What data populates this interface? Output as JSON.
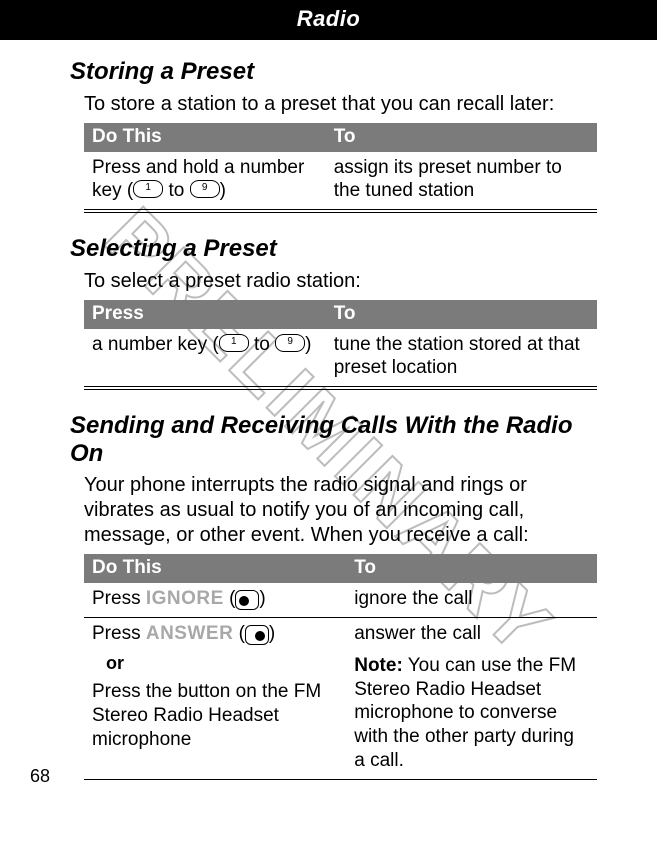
{
  "header": {
    "title": "Radio"
  },
  "watermark": "PRELIMINARY",
  "page_number": "68",
  "sections": [
    {
      "heading": "Storing a Preset",
      "intro": "To store a station to a preset that you can recall later:",
      "table": {
        "head": [
          "Do This",
          "To"
        ],
        "rows": [
          {
            "c1_prefix": "Press and hold a number key (",
            "c1_key_from": "1",
            "c1_mid": " to ",
            "c1_key_to": "9",
            "c1_suffix": ")",
            "c2": "assign its preset number to the tuned station"
          }
        ]
      }
    },
    {
      "heading": "Selecting a Preset",
      "intro": "To select a preset radio station:",
      "table": {
        "head": [
          "Press",
          "To"
        ],
        "rows": [
          {
            "c1_prefix": "a number key (",
            "c1_key_from": "1",
            "c1_mid": " to ",
            "c1_key_to": "9",
            "c1_suffix": ")",
            "c2": "tune the station stored at that preset location"
          }
        ]
      }
    },
    {
      "heading": "Sending and Receiving Calls With the Radio On",
      "intro": "Your phone interrupts the radio signal and rings or vibrates as usual to notify you of an incoming call, message, or other event. When you receive a call:",
      "table": {
        "head": [
          "Do This",
          "To"
        ],
        "rows": [
          {
            "c1_prefix": "Press ",
            "c1_softkey": "IGNORE",
            "c1_open": " (",
            "c1_icon": "left",
            "c1_close": ")",
            "c2": "ignore the call"
          },
          {
            "c1_prefix": "Press ",
            "c1_softkey": "ANSWER",
            "c1_open": " (",
            "c1_icon": "right",
            "c1_close": ")",
            "c1_or": "or",
            "c1_more": "Press the button on the FM Stereo Radio Headset microphone",
            "c2": "answer the call",
            "c2_note_label": "Note:",
            "c2_note": " You can use the FM Stereo Radio Headset microphone to converse with the other party during a call."
          }
        ]
      }
    }
  ]
}
